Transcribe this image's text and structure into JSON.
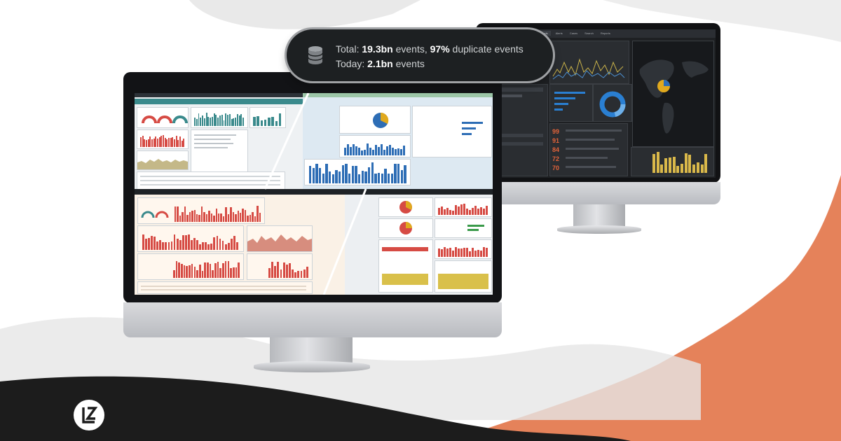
{
  "stats": {
    "line1_prefix": "Total: ",
    "line1_total": "19.3bn",
    "line1_mid": " events, ",
    "line1_dup": "97%",
    "line1_suffix": " duplicate events",
    "line2_prefix": "Today: ",
    "line2_today": "2.1bn",
    "line2_suffix": " events",
    "icon": "database-icon"
  },
  "back_monitor": {
    "tabs": [
      "Dashboards",
      "Alerts",
      "Cases",
      "Search",
      "Reports"
    ],
    "score_list": [
      "99",
      "91",
      "84",
      "72",
      "70"
    ],
    "score_color": "#e0633a"
  },
  "logo": {
    "icon": "lz-logo-icon",
    "letters": "LZ"
  },
  "colors": {
    "accent_orange": "#e5825a",
    "teal": "#3a8a8c",
    "blue": "#2d6db5",
    "red": "#d64b44",
    "gold": "#d9b84a",
    "dark_wave": "#1c1c1c"
  }
}
